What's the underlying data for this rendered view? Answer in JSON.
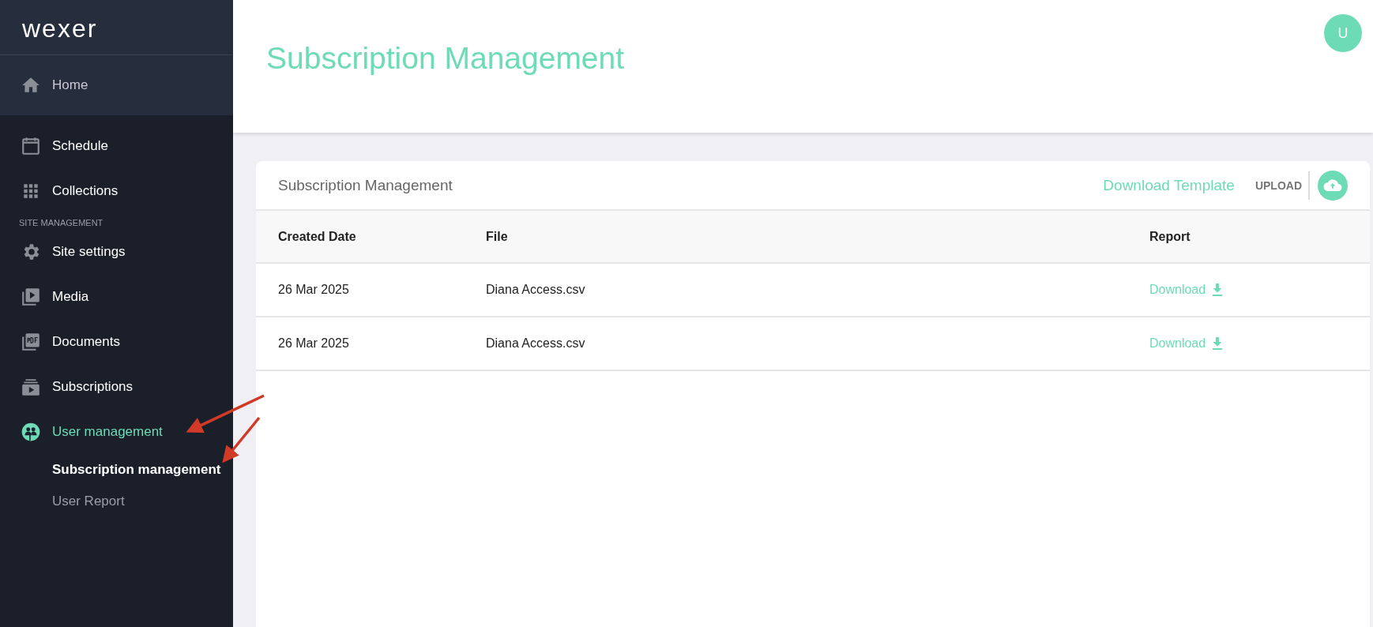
{
  "sidebar": {
    "logo": "wexer",
    "home": {
      "label": "Home"
    },
    "items": [
      {
        "kind": "link",
        "label": "Schedule",
        "active": false
      },
      {
        "kind": "link",
        "label": "Collections",
        "active": false
      },
      {
        "kind": "section",
        "label": "SITE MANAGEMENT"
      },
      {
        "kind": "link",
        "label": "Site settings",
        "active": false
      },
      {
        "kind": "link",
        "label": "Media",
        "active": false
      },
      {
        "kind": "link",
        "label": "Documents",
        "active": false
      },
      {
        "kind": "link",
        "label": "Subscriptions",
        "active": false
      },
      {
        "kind": "link",
        "label": "User management",
        "active": true,
        "children": [
          {
            "label": "Subscription management",
            "selected": true
          },
          {
            "label": "User Report",
            "selected": false
          }
        ]
      }
    ]
  },
  "header": {
    "title": "Subscription Management",
    "avatar": "U"
  },
  "card": {
    "title": "Subscription Management",
    "download_template": "Download Template",
    "upload": "UPLOAD",
    "table": {
      "columns": [
        "Created Date",
        "File",
        "Report"
      ],
      "rows": [
        {
          "created": "26 Mar 2025",
          "file": "Diana Access.csv",
          "report": "Download"
        },
        {
          "created": "26 Mar 2025",
          "file": "Diana Access.csv",
          "report": "Download"
        }
      ]
    }
  }
}
